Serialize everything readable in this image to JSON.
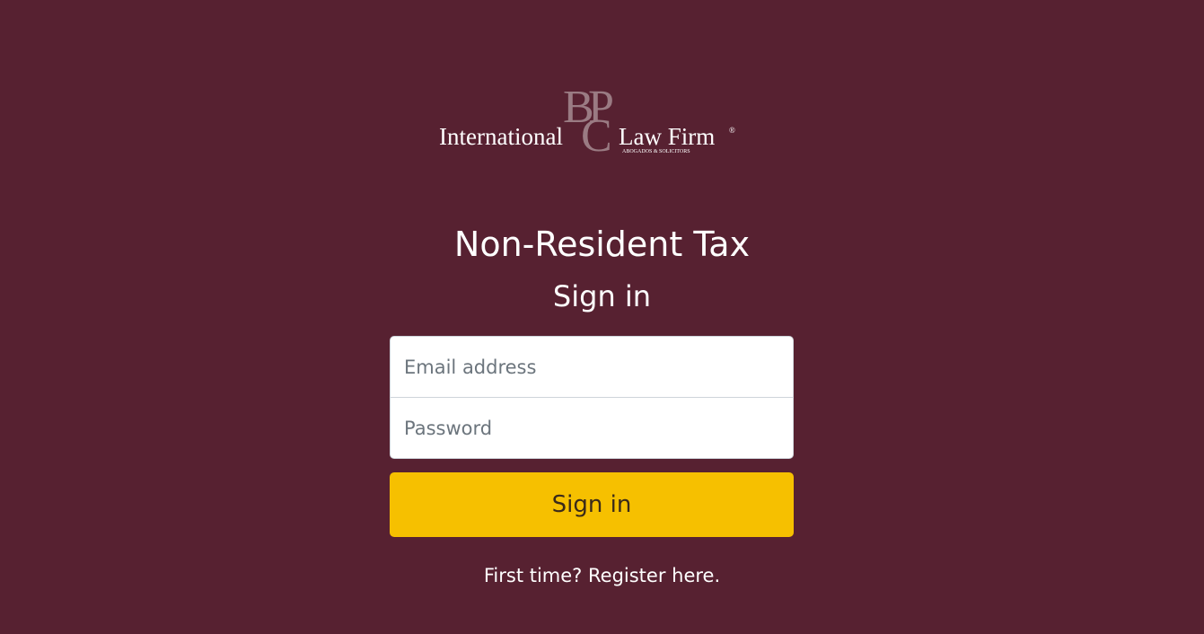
{
  "logo": {
    "monogram_b": "B",
    "monogram_c": "C",
    "monogram_p": "P",
    "left_text": "International",
    "right_text": "Law Firm",
    "registered": "®",
    "tagline": "ABOGADOS & SOLICITORS",
    "monogram_color": "#9a7b83"
  },
  "header": {
    "title": "Non-Resident Tax",
    "subtitle": "Sign in"
  },
  "form": {
    "email_placeholder": "Email address",
    "email_value": "",
    "password_placeholder": "Password",
    "password_value": "",
    "submit_label": "Sign in"
  },
  "footer": {
    "register_link": "First time? Register here."
  },
  "colors": {
    "background": "#572131",
    "button": "#f6c000"
  }
}
